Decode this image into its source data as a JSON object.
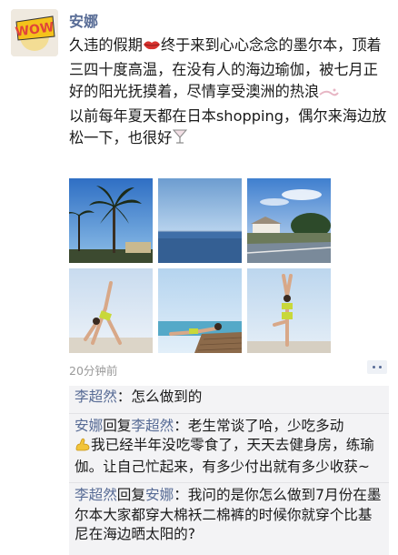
{
  "author": {
    "avatar_text": "WOW",
    "name": "安娜"
  },
  "post": {
    "paragraph1_a": "久违的假期",
    "paragraph1_b": "终于来到心心念念的墨尔本，顶着三四十度高温，在没有人的海边瑜伽，被七月正好的阳光抚摸着，尽情享受澳洲的热浪",
    "paragraph2": "以前每年夏天都在日本shopping，偶尔来海边放松一下，也很好",
    "emoji": [
      "lips-emoji",
      "sparkle-emoji",
      "cocktail-emoji"
    ],
    "photos": [
      "palm-trees-photo",
      "seascape-photo",
      "coastal-road-photo",
      "yoga-pose-photo",
      "yoga-pier-photo",
      "yoga-standing-photo"
    ],
    "time": "20分钟前"
  },
  "colors": {
    "name_link": "#576b95",
    "comment_bg": "#f3f3f5",
    "time_gray": "#9a9a9a"
  },
  "comments": [
    {
      "from": "李超然",
      "text": "：怎么做到的"
    },
    {
      "from": "安娜",
      "reply_word": "回复",
      "to": "李超然",
      "text": "：老生常谈了哈，少吃多动",
      "text2": "我已经半年没吃零食了，天天去健身房，练瑜伽。让自己忙起来，有多少付出就有多少收获~"
    },
    {
      "from": "李超然",
      "reply_word": "回复",
      "to": "安娜",
      "text": "：我问的是你怎么做到7月份在墨尔本大家都穿大棉袄二棉裤的时候你就穿个比基尼在海边晒太阳的?"
    }
  ]
}
